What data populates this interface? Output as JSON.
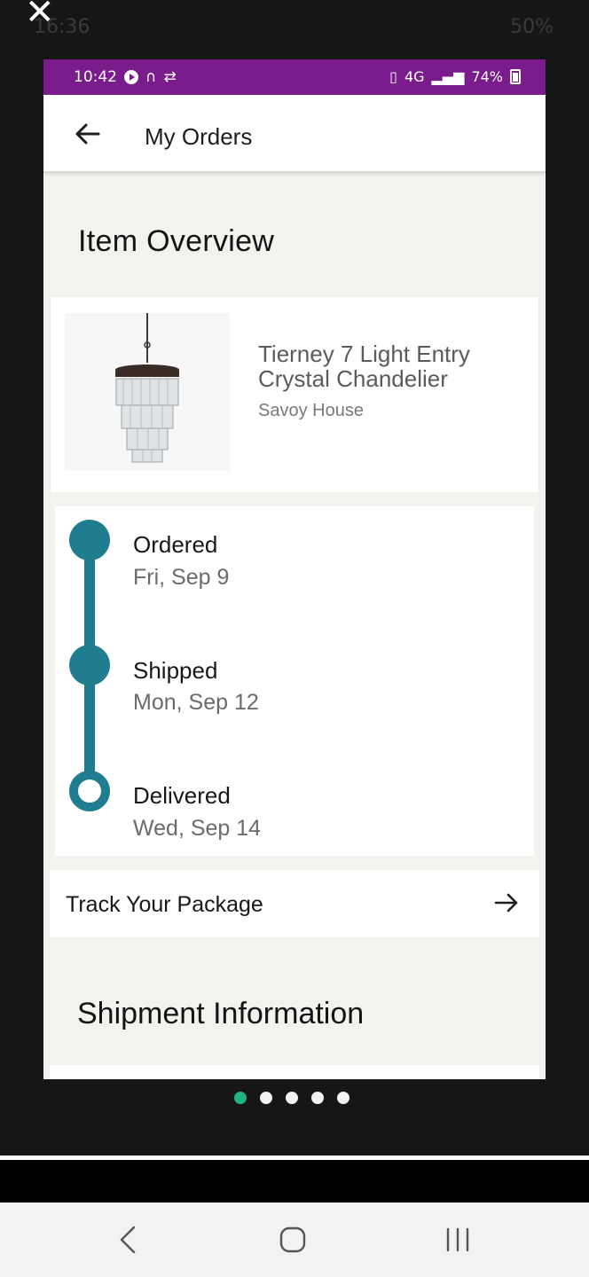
{
  "outer_status": {
    "time": "16:36",
    "battery": "50%"
  },
  "inner_status": {
    "time": "10:42",
    "network": "4G",
    "battery": "74%"
  },
  "appbar": {
    "title": "My Orders"
  },
  "overview": {
    "title": "Item Overview"
  },
  "item": {
    "name": "Tierney 7 Light Entry Crystal Chandelier",
    "brand": "Savoy House"
  },
  "timeline": [
    {
      "label": "Ordered",
      "date": "Fri, Sep 9",
      "status": "done"
    },
    {
      "label": "Shipped",
      "date": "Mon, Sep 12",
      "status": "done"
    },
    {
      "label": "Delivered",
      "date": "Wed, Sep 14",
      "status": "pending"
    }
  ],
  "track": {
    "label": "Track Your Package"
  },
  "shipment": {
    "title": "Shipment Information"
  },
  "pager": {
    "count": 5,
    "active_index": 0
  },
  "colors": {
    "accent": "#1f7d8f",
    "status_bar": "#7b1c8d",
    "pager_active": "#1fb57e"
  },
  "icons": [
    "close-icon",
    "back-arrow-icon",
    "forward-arrow-icon",
    "nav-back-icon",
    "nav-home-icon",
    "nav-recents-icon"
  ]
}
